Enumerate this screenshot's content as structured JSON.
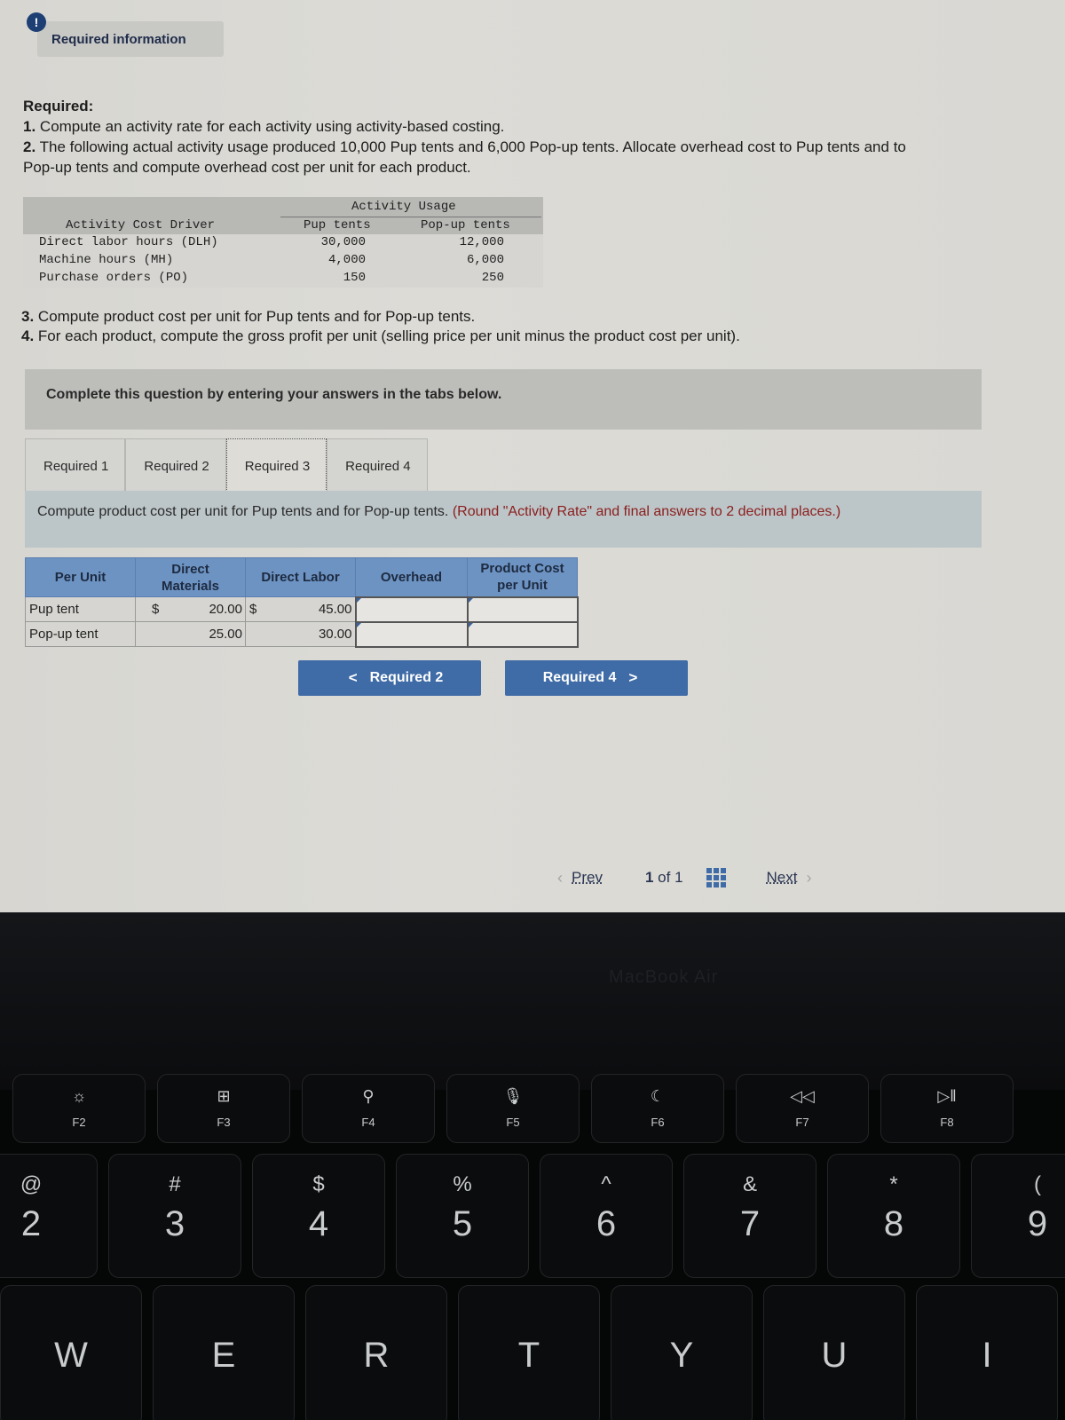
{
  "info": {
    "icon": "info-exclamation-icon",
    "label": "Required information"
  },
  "required": {
    "heading": "Required:",
    "items": [
      {
        "num": "1.",
        "text": " Compute an activity rate for each activity using activity-based costing."
      },
      {
        "num": "2.",
        "text": " The following actual activity usage produced 10,000 Pup tents and 6,000 Pop-up tents. Allocate overhead cost to Pup tents and to"
      },
      {
        "num": "",
        "text": "Pop-up tents and compute overhead cost per unit for each product."
      }
    ],
    "items_after": [
      {
        "num": "3.",
        "text": " Compute product cost per unit for Pup tents and for Pop-up tents."
      },
      {
        "num": "4.",
        "text": " For each product, compute the gross profit per unit (selling price per unit minus the product cost per unit)."
      }
    ]
  },
  "usage_table": {
    "group_header": "Activity Usage",
    "columns": [
      "Activity Cost Driver",
      "Pup tents",
      "Pop-up tents"
    ],
    "rows": [
      [
        "Direct labor hours (DLH)",
        "30,000",
        "12,000"
      ],
      [
        "Machine hours (MH)",
        "4,000",
        "6,000"
      ],
      [
        "Purchase orders (PO)",
        "150",
        "250"
      ]
    ]
  },
  "instructions": "Complete this question by entering your answers in the tabs below.",
  "tabs": [
    {
      "label": "Required 1",
      "active": false
    },
    {
      "label": "Required 2",
      "active": false
    },
    {
      "label": "Required 3",
      "active": true
    },
    {
      "label": "Required 4",
      "active": false
    }
  ],
  "prompt": {
    "text": "Compute product cost per unit for Pup tents and for Pop-up tents. ",
    "note": "(Round \"Activity Rate\" and final answers to 2 decimal places.)"
  },
  "cost_table": {
    "headers": [
      "Per Unit",
      "Direct Materials",
      "Direct Labor",
      "Overhead",
      "Product Cost per Unit"
    ],
    "rows": [
      {
        "label": "Pup tent",
        "dm_currency": "$",
        "dm": "20.00",
        "dl_currency": "$",
        "dl": "45.00",
        "overhead": "",
        "product_cost": ""
      },
      {
        "label": "Pop-up tent",
        "dm_currency": "",
        "dm": "25.00",
        "dl_currency": "",
        "dl": "30.00",
        "overhead": "",
        "product_cost": ""
      }
    ]
  },
  "nav": {
    "prev_label": "Required 2",
    "next_label": "Required 4",
    "prev_chevron": "<",
    "next_chevron": ">"
  },
  "pager": {
    "prev": "Prev",
    "current": "1",
    "of_text": "of 1",
    "next": "Next"
  },
  "bezel_brand": "MacBook Air",
  "keyboard": {
    "fkeys": [
      {
        "icon": "☼",
        "label": "F2",
        "name": "brightness-up-icon"
      },
      {
        "icon": "⊞",
        "label": "F3",
        "name": "mission-control-icon"
      },
      {
        "icon": "⚲",
        "label": "F4",
        "name": "search-icon"
      },
      {
        "icon": "🎙",
        "label": "F5",
        "name": "microphone-icon"
      },
      {
        "icon": "☾",
        "label": "F6",
        "name": "moon-icon"
      },
      {
        "icon": "◁◁",
        "label": "F7",
        "name": "rewind-icon"
      },
      {
        "icon": "▷‖",
        "label": "F8",
        "name": "play-pause-icon"
      }
    ],
    "number_keys": [
      {
        "sym": "@",
        "digit": "2"
      },
      {
        "sym": "#",
        "digit": "3"
      },
      {
        "sym": "$",
        "digit": "4"
      },
      {
        "sym": "%",
        "digit": "5"
      },
      {
        "sym": "^",
        "digit": "6"
      },
      {
        "sym": "&",
        "digit": "7"
      },
      {
        "sym": "*",
        "digit": "8"
      },
      {
        "sym": "(",
        "digit": "9"
      }
    ],
    "letter_keys": [
      "W",
      "E",
      "R",
      "T",
      "Y",
      "U",
      "I"
    ]
  }
}
